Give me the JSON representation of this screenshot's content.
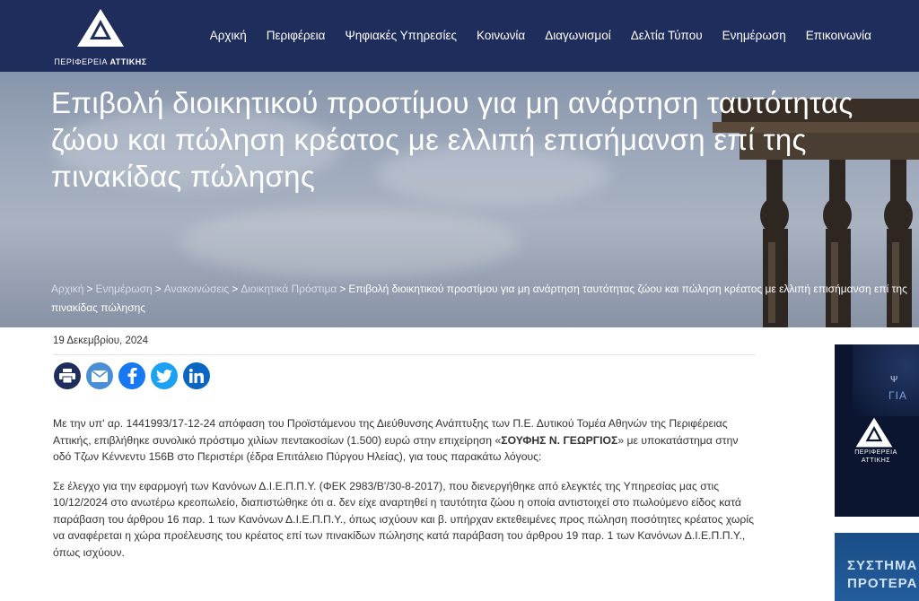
{
  "header": {
    "logo_text_1": "ΠΕΡΙΦΕΡΕΙΑ",
    "logo_text_2": "ΑΤΤΙΚΗΣ",
    "nav": [
      "Αρχική",
      "Περιφέρεια",
      "Ψηφιακές Υπηρεσίες",
      "Κοινωνία",
      "Διαγωνισμοί",
      "Δελτία Τύπου",
      "Ενημέρωση",
      "Επικοινωνία"
    ]
  },
  "hero": {
    "title_line1": "Επιβολή διοικητικού προστίμου για μη ανάρτηση ταυτότητας",
    "title_line2": "ζώου και πώληση κρέατος με ελλιπή επισήμανση επί της",
    "title_line3": "πινακίδας πώλησης"
  },
  "breadcrumb": {
    "items": [
      "Αρχική",
      "Ενημέρωση",
      "Ανακοινώσεις",
      "Διοικητικά Πρόστιμα"
    ],
    "separator": ">",
    "current": "Επιβολή διοικητικού προστίμου για μη ανάρτηση ταυτότητας ζώου και πώληση κρέατος με ελλιπή επισήμανση επί της πινακίδας πώλησης"
  },
  "article": {
    "date": "19 Δεκεμβρίου, 2024",
    "share_icons": [
      "print-icon",
      "email-icon",
      "facebook-icon",
      "twitter-icon",
      "linkedin-icon"
    ],
    "p1_before": "Με την υπ' αρ. 1441993/17-12-24 απόφαση του Προϊστάμενου της Διεύθυνσης Ανάπτυξης των Π.Ε. Δυτικού Τομέα Αθηνών της Περιφέρειας Αττικής, επιβλήθηκε συνολικό πρόστιμο χιλίων πεντακοσίων (1.500) ευρώ στην επιχείρηση «",
    "p1_bold": "ΣΟΥΦΗΣ Ν. ΓΕΩΡΓΙΟΣ",
    "p1_after": "» με υποκατάστημα στην οδό Τζων Κέννεντυ 156Β στο Περιστέρι (έδρα Επιτάλειο Πύργου Ηλείας), για τους παρακάτω λόγους:",
    "p2": "Σε έλεγχο για την εφαρμογή των Κανόνων Δ.Ι.Ε.Π.Π.Υ. (ΦΕΚ 2983/Β'/30-8-2017), που διενεργήθηκε από ελεγκτές της Υπηρεσίας μας στις 10/12/2024 στο ανωτέρω κρεοπωλείο, διαπιστώθηκε ότι α. δεν είχε αναρτηθεί η ταυτότητα ζώου η οποία αντιστοιχεί στο πωλούμενο είδος κατά παράβαση του άρθρου 16 παρ. 1  των Κανόνων Δ.Ι.Ε.Π.Π.Υ., όπως ισχύουν και  β. υπήρχαν εκτεθειμένες προς πώληση ποσότητες κρέατος χωρίς να αναφέρεται η χώρα προέλευσης του κρέατος επί των πινακίδων πώλησης κατά παράβαση του άρθρου 19 παρ. 1 των Κανόνων Δ.Ι.Ε.Π.Π.Υ., όπως ισχύουν."
  },
  "sidebar": {
    "banner1_text1": "Ψ",
    "banner1_text2": "ΓΙΑ",
    "banner1_logo_1": "ΠΕΡΙΦΕΡΕΙΑ",
    "banner1_logo_2": "ΑΤΤΙΚΗΣ",
    "banner2_line1": "ΣΥΣΤΗΜΑ",
    "banner2_line2": "ΠΡΟΤΕΡΑ"
  },
  "colors": {
    "header_bg": "#1f2d5c",
    "share_print": "#1f2d5c",
    "share_email": "#4a8fd6",
    "share_facebook": "#1877f2",
    "share_twitter": "#1da1f2",
    "share_linkedin": "#0a66c2"
  }
}
